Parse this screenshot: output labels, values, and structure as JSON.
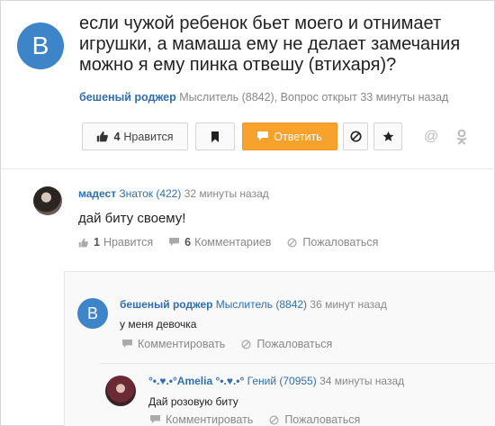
{
  "question": {
    "avatar_letter": "B",
    "title": "если чужой ребенок бьет моего и отнимает игрушки, а мамаша ему не делает замечания можно я ему пинка отвешу (втихаря)?",
    "author": "бешеный роджер",
    "rank": "Мыслитель (8842)",
    "time": ", Вопрос открыт 33 минуты назад",
    "like_count": "4",
    "like_label": "Нравится",
    "answer_label": "Ответить"
  },
  "answer": {
    "author": "мадест",
    "rank": "Знаток (422)",
    "time": "32 минуты назад",
    "text": "дай биту своему!",
    "likes_count": "1",
    "likes_label": "Нравится",
    "comments_count": "6",
    "comments_label": "Комментариев",
    "report_label": "Пожаловаться"
  },
  "comments": [
    {
      "avatar_letter": "B",
      "author": "бешеный роджер",
      "rank": "Мыслитель (8842)",
      "time": "36 минут назад",
      "text": "у меня девочка",
      "comment_label": "Комментировать",
      "report_label": "Пожаловаться"
    },
    {
      "author": "°•.♥.•°Amelia °•.♥.•°",
      "rank": "Гений (70955)",
      "time": "34 минуты назад",
      "text": "Дай розовую биту",
      "comment_label": "Комментировать",
      "report_label": "Пожаловаться"
    }
  ],
  "colors": {
    "accent": "#f6a22c",
    "link": "#2f6fb1",
    "avatar": "#3e84c8"
  },
  "icons": [
    "thumbs-up-icon",
    "bookmark-icon",
    "comment-icon",
    "block-icon",
    "star-icon",
    "at-icon",
    "odnoklassniki-icon",
    "report-icon"
  ]
}
